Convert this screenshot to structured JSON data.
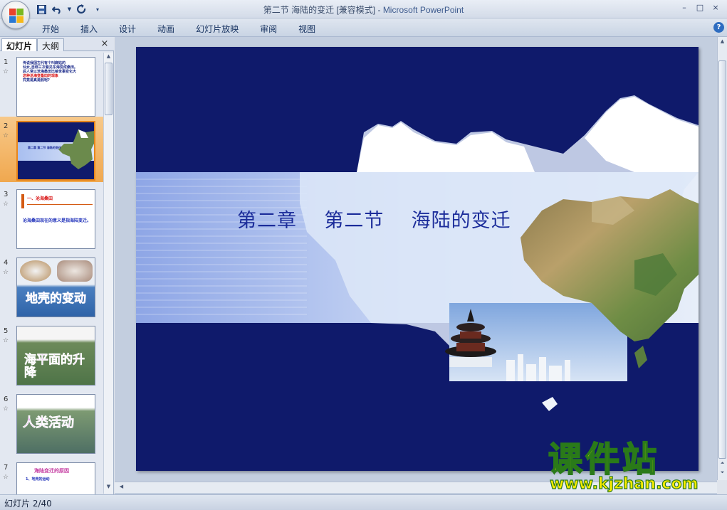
{
  "window": {
    "title": "第二节 海陆的变迁 [兼容模式]",
    "separator": " - ",
    "app_name": "Microsoft PowerPoint",
    "minimize": "–",
    "restore": "□",
    "close": "×"
  },
  "qat": {
    "save_icon": "save-icon",
    "undo_icon": "undo-icon",
    "redo_icon": "redo-icon",
    "customize_icon": "dropdown-icon"
  },
  "ribbon": {
    "tabs": [
      "开始",
      "插入",
      "设计",
      "动画",
      "幻灯片放映",
      "审阅",
      "视图"
    ],
    "help": "?"
  },
  "left_pane": {
    "tabs": {
      "slides": "幻灯片",
      "outline": "大纲"
    },
    "close": "×",
    "thumbnails": [
      {
        "num": "1",
        "star": "☆",
        "lines": [
          "传说我国古代有个叫麻姑的",
          "仙女,自称三次看见东海变成桑田。",
          "后人常以沧海桑田比喻世事变化大",
          "这种沧海变桑田的现象",
          "究竟是真是假呢?"
        ]
      },
      {
        "num": "2",
        "star": "☆",
        "caption": "第二章  第二节  海陆的变迁"
      },
      {
        "num": "3",
        "star": "☆",
        "heading": "一、沧海桑田",
        "body": "沧海桑田现在的意义是指海陆变迁。"
      },
      {
        "num": "4",
        "star": "☆",
        "caption": "地壳的变动"
      },
      {
        "num": "5",
        "star": "☆",
        "caption": "海平面的升降"
      },
      {
        "num": "6",
        "star": "☆",
        "caption": "人类活动"
      },
      {
        "num": "7",
        "star": "☆",
        "heading": "海陆变迁的原因",
        "body": "1、地壳的运动"
      }
    ]
  },
  "slide": {
    "title": "第二章    第二节    海陆的变迁"
  },
  "status": {
    "slide_counter": "幻灯片 2/40"
  },
  "watermark": {
    "title": "课件站",
    "url": "www.kjzhan.com"
  },
  "colors": {
    "slide_bg": "#0f1a6b",
    "title_text": "#1b2c9a",
    "selection": "#f0a84f",
    "watermark": "#ffee00"
  }
}
